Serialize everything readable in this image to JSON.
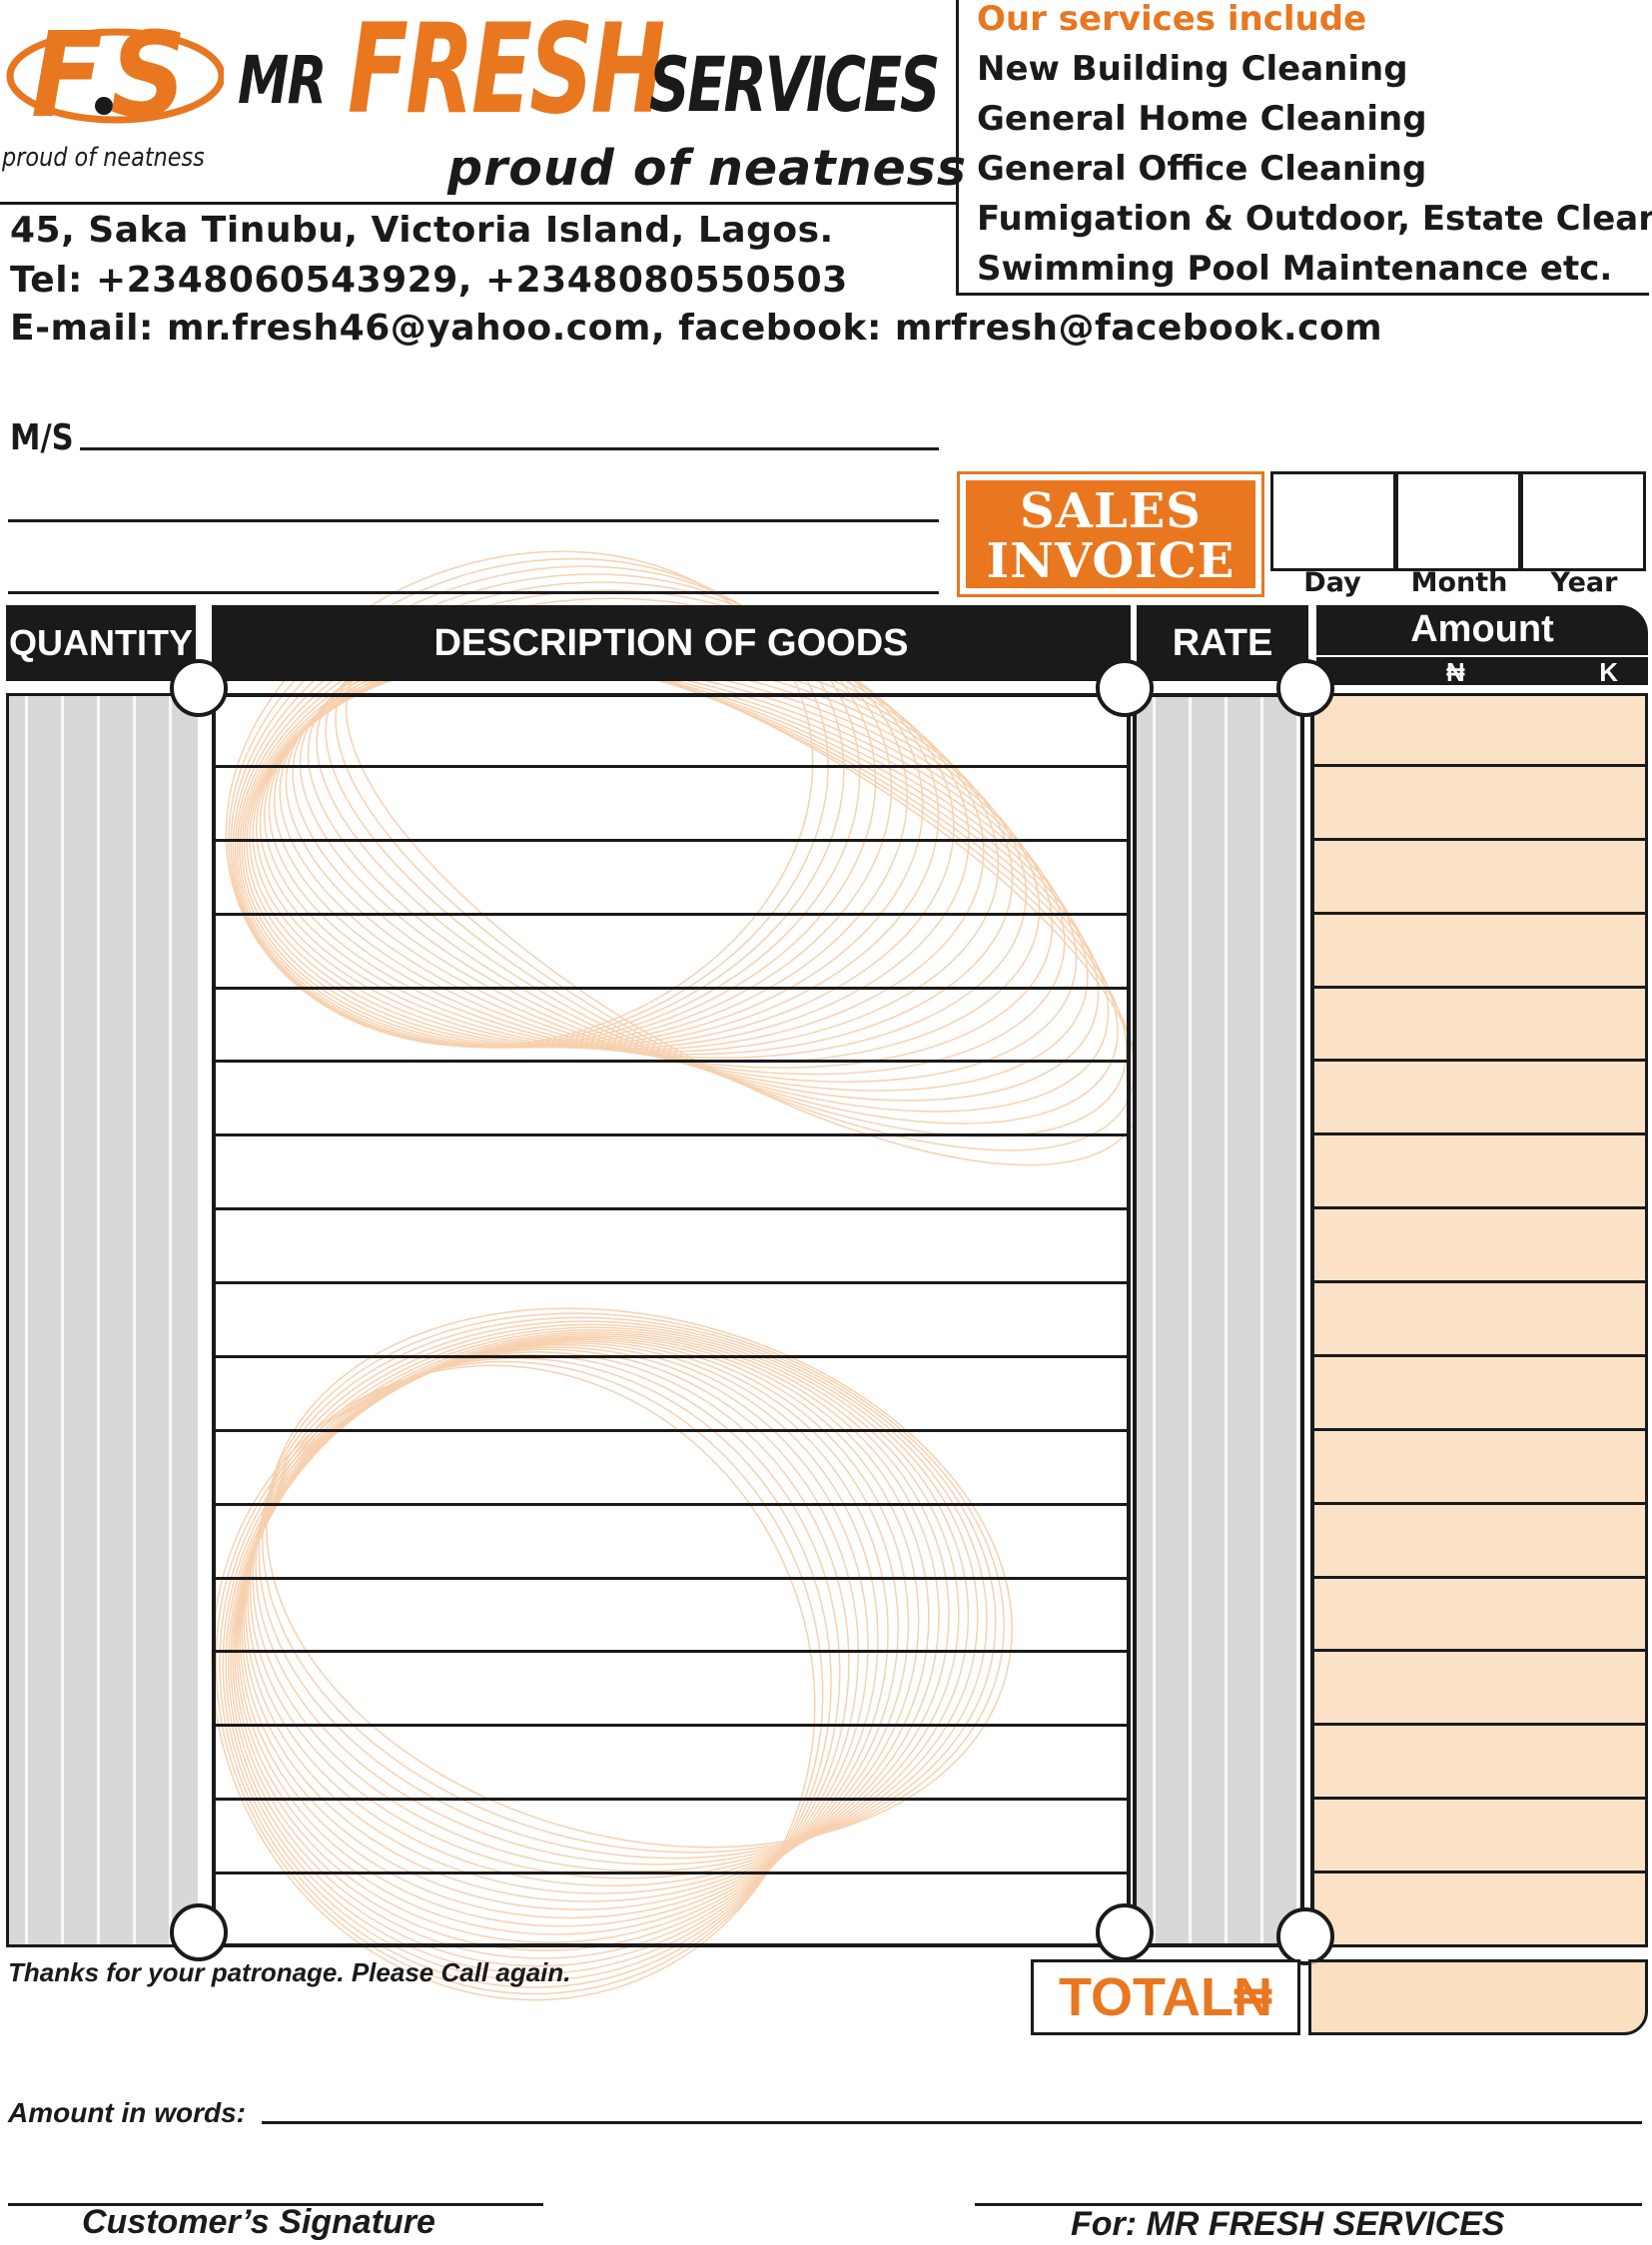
{
  "brand": {
    "logo_letters": "F.S",
    "mr": "MR",
    "fresh": "FRESH",
    "services": "SERVICES",
    "tagline_small": "proud of neatness",
    "tagline": "proud of neatness"
  },
  "services": {
    "title": "Our services include",
    "items": [
      "New Building Cleaning",
      "General Home Cleaning",
      "General Office Cleaning",
      "Fumigation & Outdoor, Estate Cleaning",
      "Swimming Pool Maintenance etc."
    ]
  },
  "contact": {
    "address": "45, Saka Tinubu, Victoria Island, Lagos.",
    "tel": "Tel: +2348060543929, +2348080550503",
    "email": "E-mail: mr.fresh46@yahoo.com, facebook: mrfresh@facebook.com"
  },
  "customer": {
    "label": "M/S"
  },
  "invoice": {
    "title_line1": "SALES",
    "title_line2": "INVOICE",
    "date_labels": [
      "Day",
      "Month",
      "Year"
    ]
  },
  "table": {
    "headers": {
      "quantity": "QUANTITY",
      "description": "DESCRIPTION OF GOODS",
      "rate": "RATE",
      "amount": "Amount",
      "naira": "₦",
      "kobo": "K"
    },
    "row_count": 17
  },
  "footer": {
    "thanks": "Thanks for your patronage. Please Call again.",
    "total_label": "TOTAL₦",
    "amount_in_words": "Amount in words:",
    "customer_signature": "Customer’s Signature",
    "for_company": "For: MR FRESH SERVICES"
  },
  "colors": {
    "accent": "#e8771f",
    "ink": "#1a1a1a",
    "shade": "#d8d8d8",
    "amount_bg": "#fad7b2"
  }
}
